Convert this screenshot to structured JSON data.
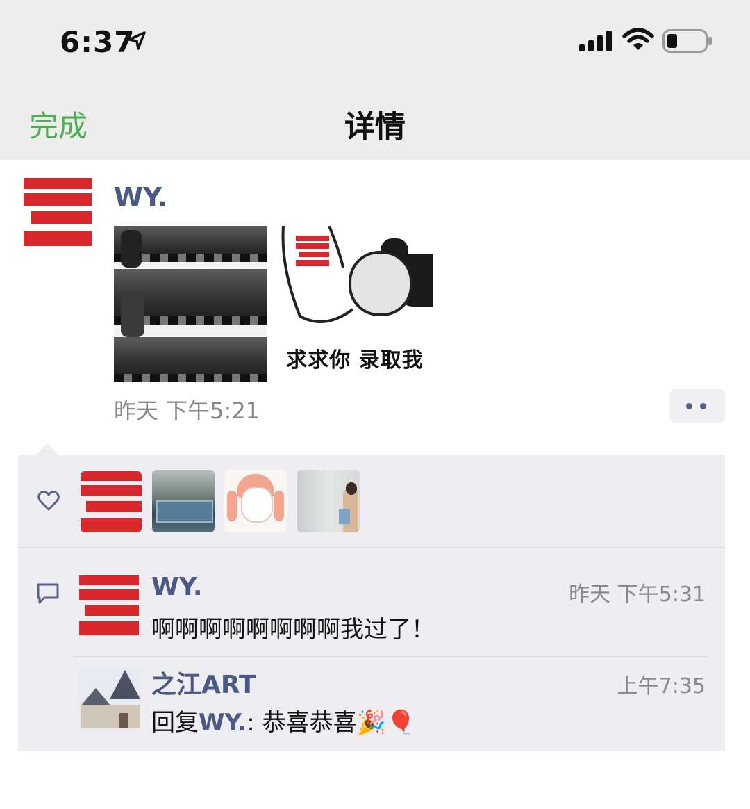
{
  "status_bar": {
    "time": "6:37"
  },
  "nav": {
    "done_label": "完成",
    "title": "详情"
  },
  "post": {
    "author": "WY.",
    "image_caption": "求求你 录取我",
    "time": "昨天 下午5:21"
  },
  "likes": {
    "avatars": [
      "logo-avatar",
      "campus-sign-avatar",
      "cartoon-girl-avatar",
      "person-photo-avatar"
    ]
  },
  "comments": [
    {
      "name": "WY.",
      "time": "昨天 下午5:31",
      "text": "啊啊啊啊啊啊啊啊我过了！"
    },
    {
      "name": "之江ART",
      "time": "上午7:35",
      "reply_prefix": "回复",
      "reply_target": "WY.",
      "reply_sep": ": ",
      "text": "恭喜恭喜🎉🎈"
    }
  ],
  "colors": {
    "brand_red": "#d8282c",
    "link_blue": "#4a5a84",
    "done_green": "#4caf50",
    "bar_gray": "#ededed"
  }
}
